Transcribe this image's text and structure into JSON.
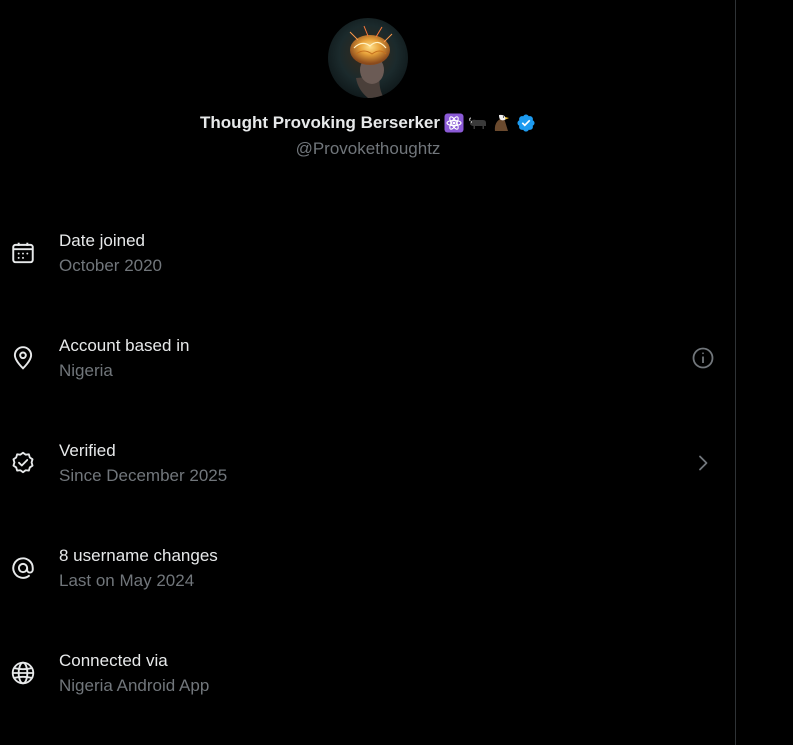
{
  "profile": {
    "display_name": "Thought Provoking Berserker",
    "handle": "@Provokethoughtz",
    "name_emojis": [
      "atom-symbol-icon",
      "bull-icon",
      "eagle-icon"
    ],
    "verified_badge": "verified-badge-icon",
    "verified_color": "#1d9bf0"
  },
  "rows": [
    {
      "icon": "calendar-icon",
      "title": "Date joined",
      "subtitle": "October 2020"
    },
    {
      "icon": "location-pin-icon",
      "title": "Account based in",
      "subtitle": "Nigeria",
      "trailing_icon": "info-icon"
    },
    {
      "icon": "verified-outline-icon",
      "title": "Verified",
      "subtitle": "Since December 2025",
      "trailing_icon": "chevron-right-icon"
    },
    {
      "icon": "at-sign-icon",
      "title": "8 username changes",
      "subtitle": "Last on May 2024"
    },
    {
      "icon": "globe-icon",
      "title": "Connected via",
      "subtitle": "Nigeria Android App"
    }
  ],
  "colors": {
    "background": "#000000",
    "primary_text": "#e7e9ea",
    "secondary_text": "#71767b",
    "divider": "#2f3336"
  }
}
